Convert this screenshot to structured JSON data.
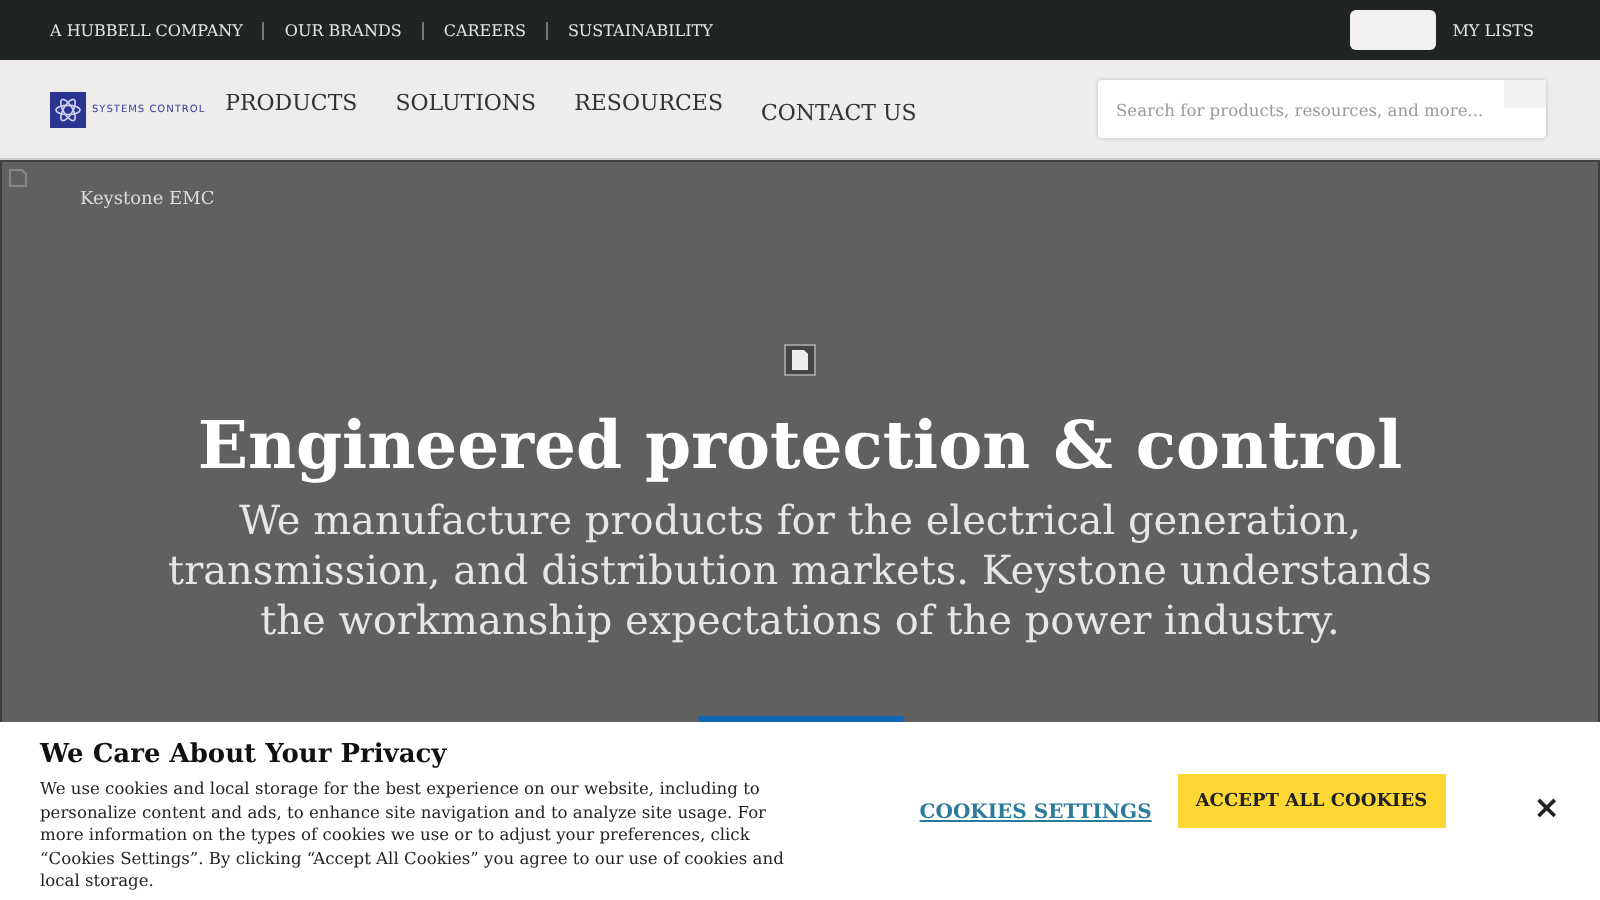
{
  "top_bar": {
    "links": [
      "A HUBBELL COMPANY",
      "OUR BRANDS",
      "CAREERS",
      "SUSTAINABILITY"
    ],
    "my_lists": "MY LISTS"
  },
  "header": {
    "logo_text": "SYSTEMS CONTROL",
    "nav": [
      "PRODUCTS",
      "SOLUTIONS",
      "RESOURCES",
      "CONTACT US"
    ],
    "search": {
      "placeholder": "Search for products, resources, and more..."
    }
  },
  "hero": {
    "eyebrow": "Keystone EMC",
    "title": "Engineered protection & control",
    "subtitle": "We manufacture products for the electrical generation, transmission, and distribution markets. Keystone understands the workmanship expectations of the power industry."
  },
  "cookie_banner": {
    "title": "We Care About Your Privacy",
    "text": "We use cookies and local storage for the best experience on our website, including to personalize content and ads, to enhance site navigation and to analyze site usage. For more information on the types of cookies we use or to adjust your preferences, click “Cookies Settings”. By clicking “Accept All Cookies” you agree to our use of cookies and local storage.",
    "settings": "COOKIES SETTINGS",
    "accept": "ACCEPT ALL COOKIES",
    "close": "×"
  }
}
